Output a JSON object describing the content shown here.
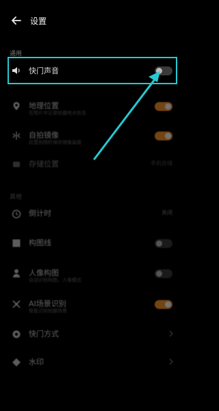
{
  "header": {
    "title": "设置"
  },
  "sections": {
    "general": "通用",
    "other": "其他"
  },
  "rows": [
    {
      "label": "快门声音",
      "toggle": "off"
    },
    {
      "label": "地理位置",
      "sub": "在照片中记录拍摄地点信息",
      "toggle": "on"
    },
    {
      "label": "自拍镜像",
      "sub": "前置拍照时保存镜像画面",
      "toggle": "on"
    },
    {
      "label": "存储位置",
      "value": "手机存储"
    },
    {
      "label": "倒计时",
      "value": "关闭"
    },
    {
      "label": "构图线",
      "toggle": "off"
    },
    {
      "label": "人像构图",
      "sub": "自动识别构图，人像模式",
      "toggle": "off"
    },
    {
      "label": "AI场景识别",
      "sub": "智能识别拍摄场景",
      "toggle": "on"
    },
    {
      "label": "快门方式"
    },
    {
      "label": "水印"
    }
  ],
  "colors": {
    "accent": "#ff9a2e",
    "highlight": "#27c9d2"
  }
}
